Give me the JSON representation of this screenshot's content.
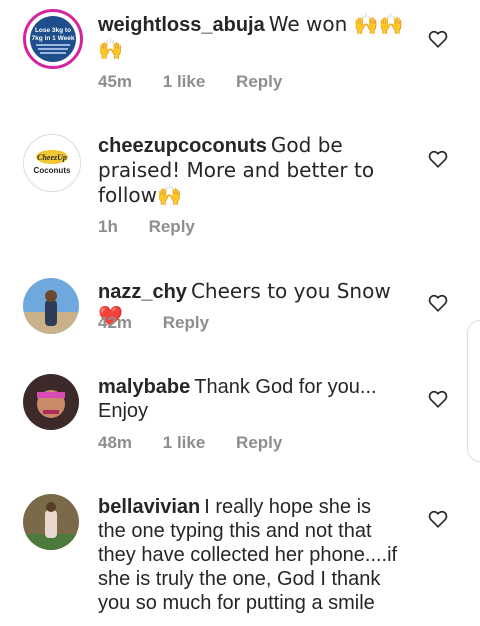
{
  "comments": [
    {
      "username": "weightloss_abuja",
      "text": "We won 🙌🙌🙌",
      "time": "45m",
      "likes": "1 like",
      "reply": "Reply",
      "avatar_text": "Lose 3kg to 7kg in 1 Week"
    },
    {
      "username": "cheezupcoconuts",
      "text": "God be praised! More and better to follow🙌",
      "time": "1h",
      "likes": "",
      "reply": "Reply",
      "avatar_text": "Coconuts"
    },
    {
      "username": "nazz_chy",
      "text": "Cheers to you Snow❤️",
      "time": "42m",
      "likes": "",
      "reply": "Reply",
      "avatar_text": ""
    },
    {
      "username": "malybabe",
      "text": "Thank God for you... Enjoy",
      "time": "48m",
      "likes": "1 like",
      "reply": "Reply",
      "avatar_text": ""
    },
    {
      "username": "bellavivian",
      "text": "I really hope she is the one typing this and not that they have collected her phone....if she is truly the one, God I thank you so much for putting a smile",
      "time": "",
      "likes": "",
      "reply": "",
      "avatar_text": ""
    }
  ],
  "icons": {
    "like": "heart-outline-icon"
  },
  "colors": {
    "meta": "#8e8e8e",
    "text": "#262626"
  }
}
